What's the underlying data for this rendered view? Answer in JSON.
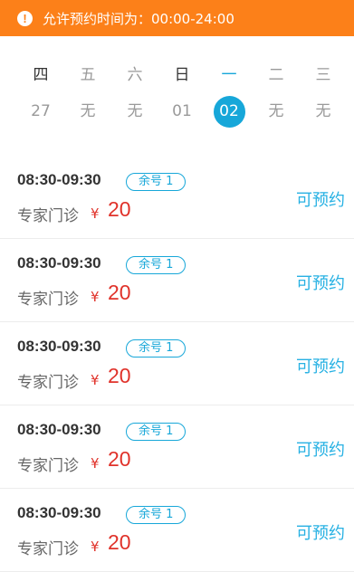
{
  "notice": {
    "icon": "exclamation-circle-icon",
    "text": "允许预约时间为：00:00-24:00",
    "color": "#fc8019"
  },
  "calendar": {
    "days": [
      {
        "weekday": "四",
        "date": "27",
        "style": "dark"
      },
      {
        "weekday": "五",
        "date": "无",
        "style": "muted"
      },
      {
        "weekday": "六",
        "date": "无",
        "style": "muted"
      },
      {
        "weekday": "日",
        "date": "01",
        "style": "dark"
      },
      {
        "weekday": "一",
        "date": "02",
        "style": "active"
      },
      {
        "weekday": "二",
        "date": "无",
        "style": "muted"
      },
      {
        "weekday": "三",
        "date": "无",
        "style": "muted"
      }
    ],
    "accent": "#17a7d9"
  },
  "slots": [
    {
      "time": "08:30-09:30",
      "remaining": "余号 1",
      "type": "专家门诊",
      "currency": "¥",
      "price": "20",
      "action": "可预约"
    },
    {
      "time": "08:30-09:30",
      "remaining": "余号 1",
      "type": "专家门诊",
      "currency": "¥",
      "price": "20",
      "action": "可预约"
    },
    {
      "time": "08:30-09:30",
      "remaining": "余号 1",
      "type": "专家门诊",
      "currency": "¥",
      "price": "20",
      "action": "可预约"
    },
    {
      "time": "08:30-09:30",
      "remaining": "余号 1",
      "type": "专家门诊",
      "currency": "¥",
      "price": "20",
      "action": "可预约"
    },
    {
      "time": "08:30-09:30",
      "remaining": "余号 1",
      "type": "专家门诊",
      "currency": "¥",
      "price": "20",
      "action": "可预约"
    }
  ],
  "colors": {
    "price": "#e0322a",
    "action": "#27b1e3"
  }
}
